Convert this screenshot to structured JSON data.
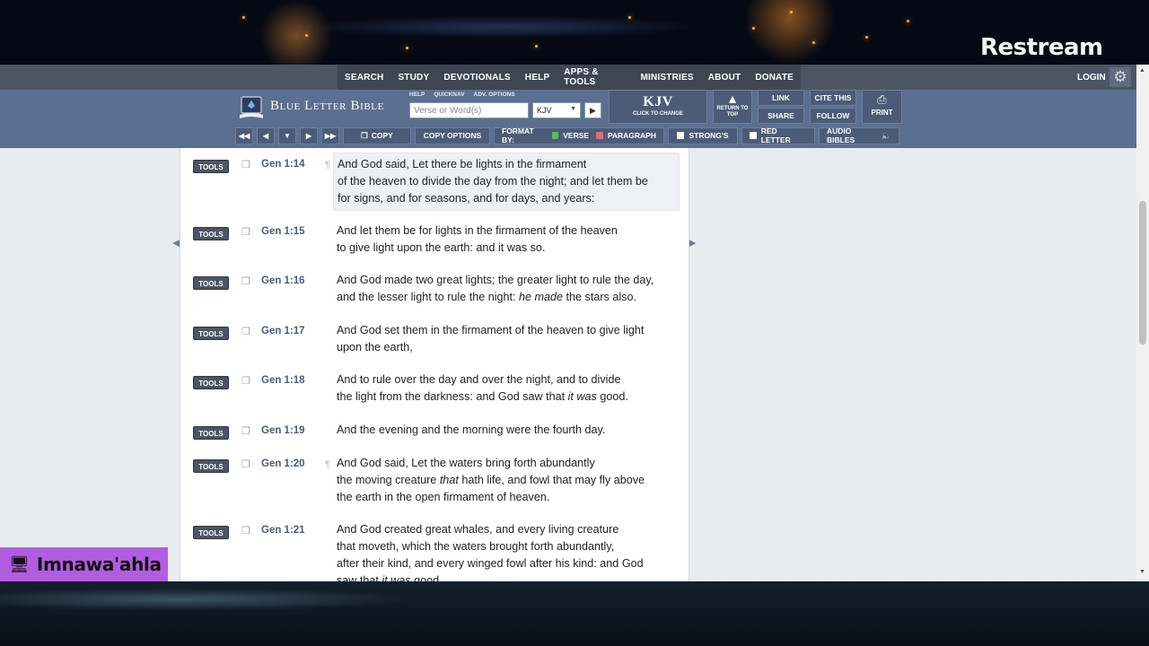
{
  "overlay": {
    "brand": "Restream",
    "streamer_name": "Imnawa'ahla"
  },
  "topnav": {
    "items": [
      "SEARCH",
      "STUDY",
      "DEVOTIONALS",
      "HELP",
      "APPS & TOOLS",
      "MINISTRIES",
      "ABOUT",
      "DONATE"
    ],
    "login": "LOGIN"
  },
  "header": {
    "logo_text": "Blue Letter Bible",
    "mini_links": [
      "HELP",
      "QUICKNAV",
      "ADV. OPTIONS"
    ],
    "search_placeholder": "Verse or Word(s)",
    "version_selected": "KJV",
    "version_box_title": "KJV",
    "version_box_sub": "CLICK TO CHANGE",
    "return_to_top": "RETURN TO TOP",
    "link": "LINK",
    "share": "SHARE",
    "cite_this": "CITE THIS",
    "follow": "FOLLOW",
    "print": "PRINT"
  },
  "toolbar": {
    "copy": "COPY",
    "copy_options": "COPY OPTIONS",
    "format_by": "FORMAT BY:",
    "verse": "VERSE",
    "paragraph": "PARAGRAPH",
    "strongs": "STRONG'S",
    "red_letter": "RED LETTER",
    "audio_bibles": "AUDIO BIBLES"
  },
  "tools_label": "TOOLS",
  "verses": [
    {
      "ref": "Gen 1:14",
      "para": true,
      "lines": [
        "And God said, Let there be lights in the firmament",
        "of the heaven to divide the day from the night; and let them be",
        "for signs, and for seasons, and for days, and years:"
      ]
    },
    {
      "ref": "Gen 1:15",
      "para": false,
      "lines": [
        "And let them be for lights in the firmament of the heaven",
        "to give light upon the earth: and it was so."
      ]
    },
    {
      "ref": "Gen 1:16",
      "para": false,
      "lines": [
        "And God made two great lights; the greater light to rule the day,",
        "and the lesser light to rule the night: he made the stars also."
      ]
    },
    {
      "ref": "Gen 1:17",
      "para": false,
      "lines": [
        "And God set them in the firmament of the heaven to give light",
        "upon the earth,"
      ]
    },
    {
      "ref": "Gen 1:18",
      "para": false,
      "lines": [
        "And to rule over the day and over the night, and to divide",
        "the light from the darkness: and God saw that it was good."
      ]
    },
    {
      "ref": "Gen 1:19",
      "para": false,
      "lines": [
        "And the evening and the morning were the fourth day."
      ]
    },
    {
      "ref": "Gen 1:20",
      "para": true,
      "lines": [
        "And God said, Let the waters bring forth abundantly",
        "the moving creature that hath life, and fowl that may fly above",
        "the earth in the open firmament of heaven."
      ]
    },
    {
      "ref": "Gen 1:21",
      "para": false,
      "lines": [
        "And God created great whales, and every living creature",
        "that moveth, which the waters brought forth abundantly,",
        "after their kind, and every winged fowl after his kind: and God",
        "saw that it was good."
      ]
    }
  ]
}
